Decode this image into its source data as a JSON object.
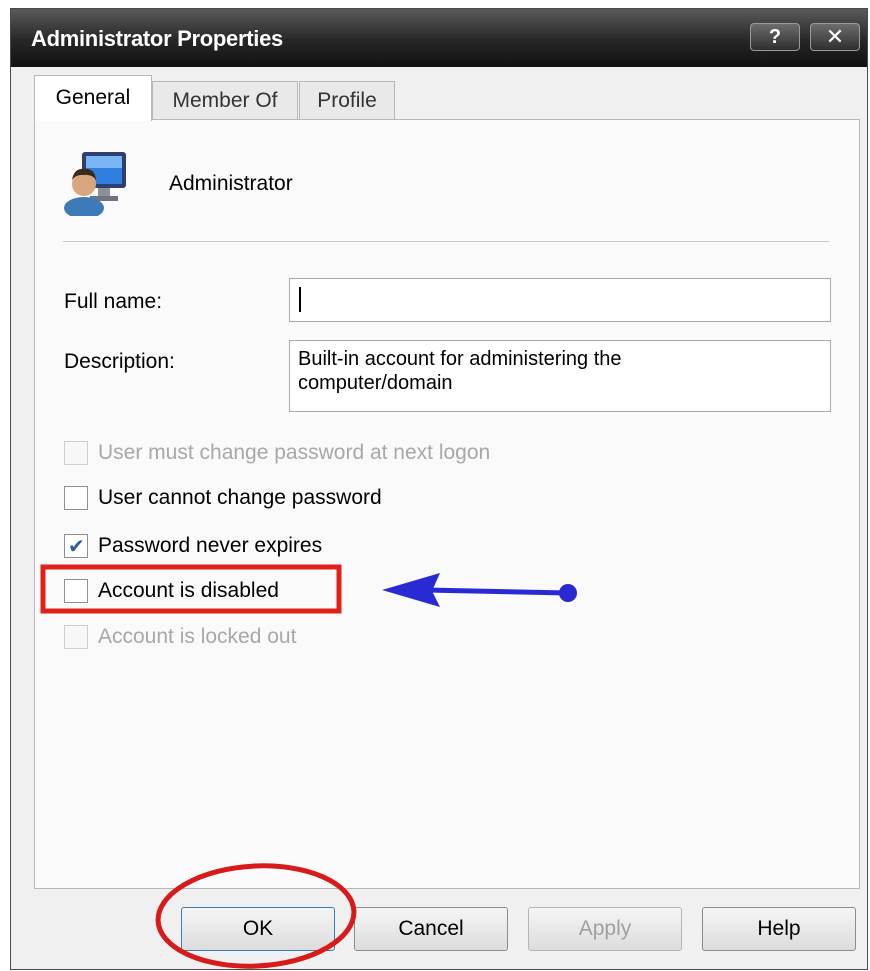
{
  "window": {
    "title": "Administrator Properties",
    "help_glyph": "?",
    "close_glyph": "✕"
  },
  "tabs": [
    {
      "label": "General",
      "active": true
    },
    {
      "label": "Member Of",
      "active": false
    },
    {
      "label": "Profile",
      "active": false
    }
  ],
  "account": {
    "icon": "user-computer-icon",
    "name": "Administrator"
  },
  "fields": {
    "full_name_label": "Full name:",
    "full_name_value": "",
    "description_label": "Description:",
    "description_value": "Built-in account for administering the\ncomputer/domain"
  },
  "options": [
    {
      "label": "User must change password at next logon",
      "checked": false,
      "enabled": false
    },
    {
      "label": "User cannot change password",
      "checked": false,
      "enabled": true
    },
    {
      "label": "Password never expires",
      "checked": true,
      "enabled": true
    },
    {
      "label": "Account is disabled",
      "checked": false,
      "enabled": true
    },
    {
      "label": "Account is locked out",
      "checked": false,
      "enabled": false
    }
  ],
  "annotations": {
    "highlight_box_color": "#e0201b",
    "arrow_color": "#2a2ad4",
    "ok_circle_color": "#d81a1a"
  },
  "buttons": {
    "ok": "OK",
    "cancel": "Cancel",
    "apply": "Apply",
    "help": "Help"
  }
}
